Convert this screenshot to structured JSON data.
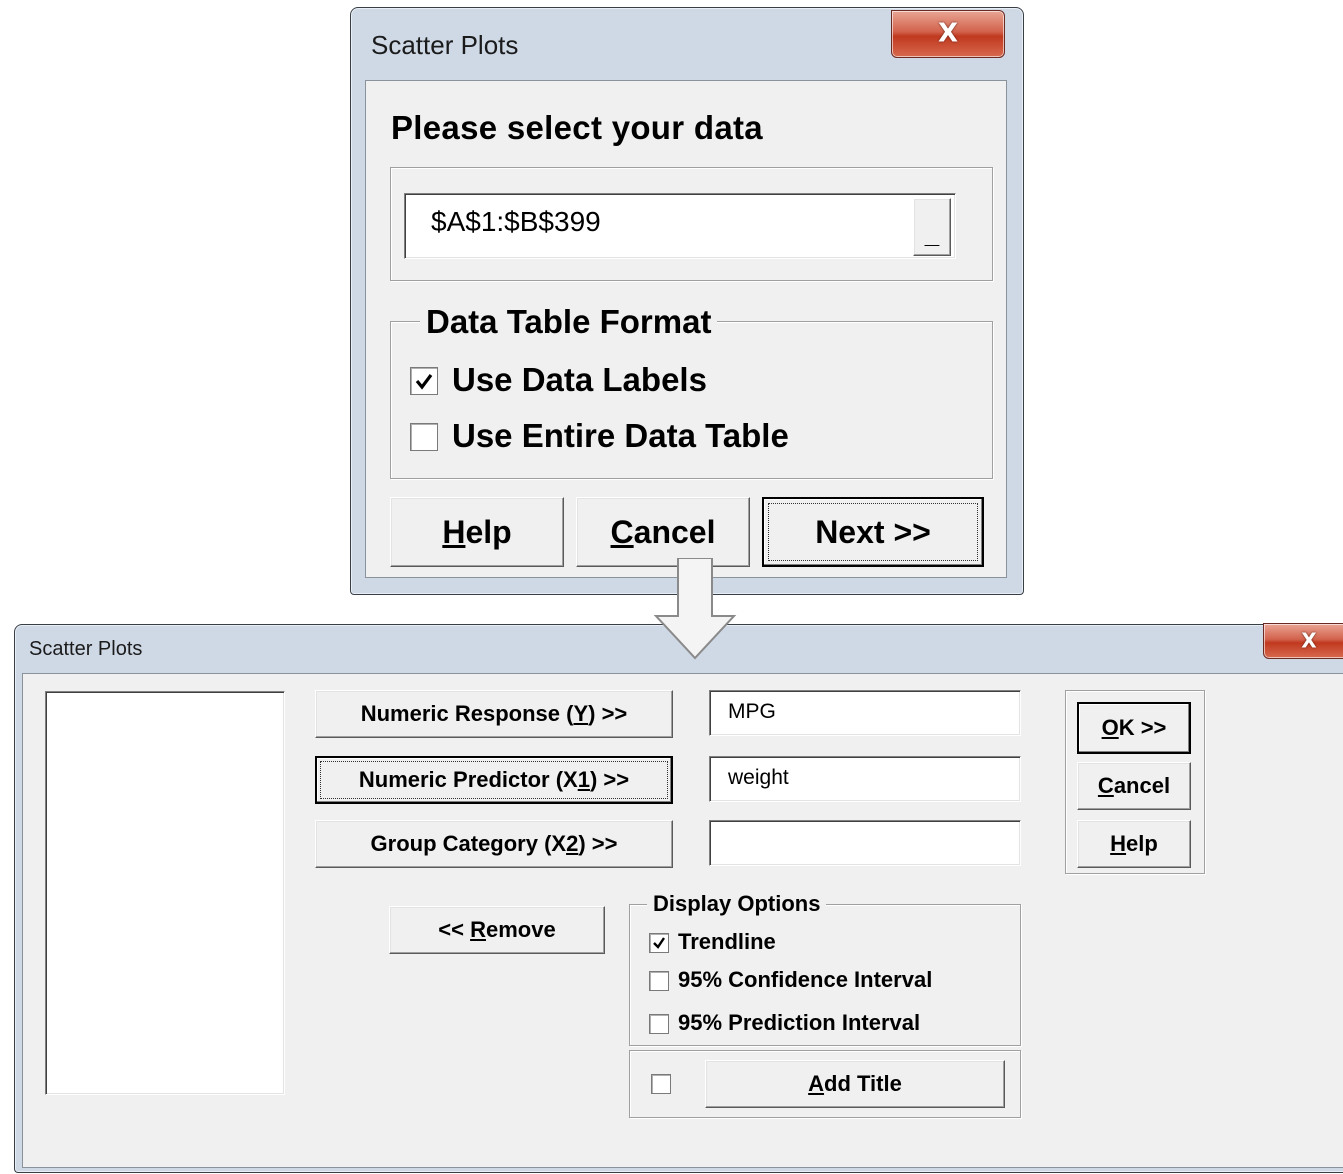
{
  "select_dialog": {
    "title": "Scatter Plots",
    "close_label": "X",
    "heading": "Please select your data",
    "range_value": "$A$1:$B$399",
    "range_button_label": "_",
    "format_group": {
      "legend": "Data Table Format",
      "use_data_labels": {
        "label": "Use Data Labels",
        "checked": true
      },
      "use_entire_table": {
        "label": "Use Entire Data Table",
        "checked": false
      }
    },
    "buttons": {
      "help": {
        "mnemonic": "H",
        "rest": "elp"
      },
      "cancel": {
        "mnemonic": "C",
        "rest": "ancel"
      },
      "next": "Next >>"
    }
  },
  "options_dialog": {
    "title": "Scatter Plots",
    "close_label": "X",
    "variables_list": [],
    "role_buttons": {
      "response": {
        "before": "Numeric Response (",
        "mnemonic": "Y",
        "after": ") >>"
      },
      "predictor": {
        "before": "Numeric Predictor (X",
        "mnemonic": "1",
        "after": ") >>"
      },
      "group": {
        "before": "Group Category (X",
        "mnemonic": "2",
        "after": ") >>"
      }
    },
    "role_values": {
      "response": "MPG",
      "predictor": "weight",
      "group": ""
    },
    "remove_button": {
      "before": "<< ",
      "mnemonic": "R",
      "rest": "emove"
    },
    "display_options": {
      "legend": "Display Options",
      "trendline": {
        "label": "Trendline",
        "checked": true
      },
      "confidence": {
        "label": "95% Confidence Interval",
        "checked": false
      },
      "prediction": {
        "label": "95% Prediction Interval",
        "checked": false
      }
    },
    "add_title": {
      "checked": false,
      "mnemonic": "A",
      "rest": "dd Title"
    },
    "action_buttons": {
      "ok": {
        "mnemonic": "O",
        "rest": "K >>"
      },
      "cancel": {
        "mnemonic": "C",
        "rest": "ancel"
      },
      "help": {
        "mnemonic": "H",
        "rest": "elp"
      }
    }
  },
  "colors": {
    "window_frame": "#cfd9e6",
    "client_face": "#f0f0f0",
    "close_button": "#c8452a"
  }
}
